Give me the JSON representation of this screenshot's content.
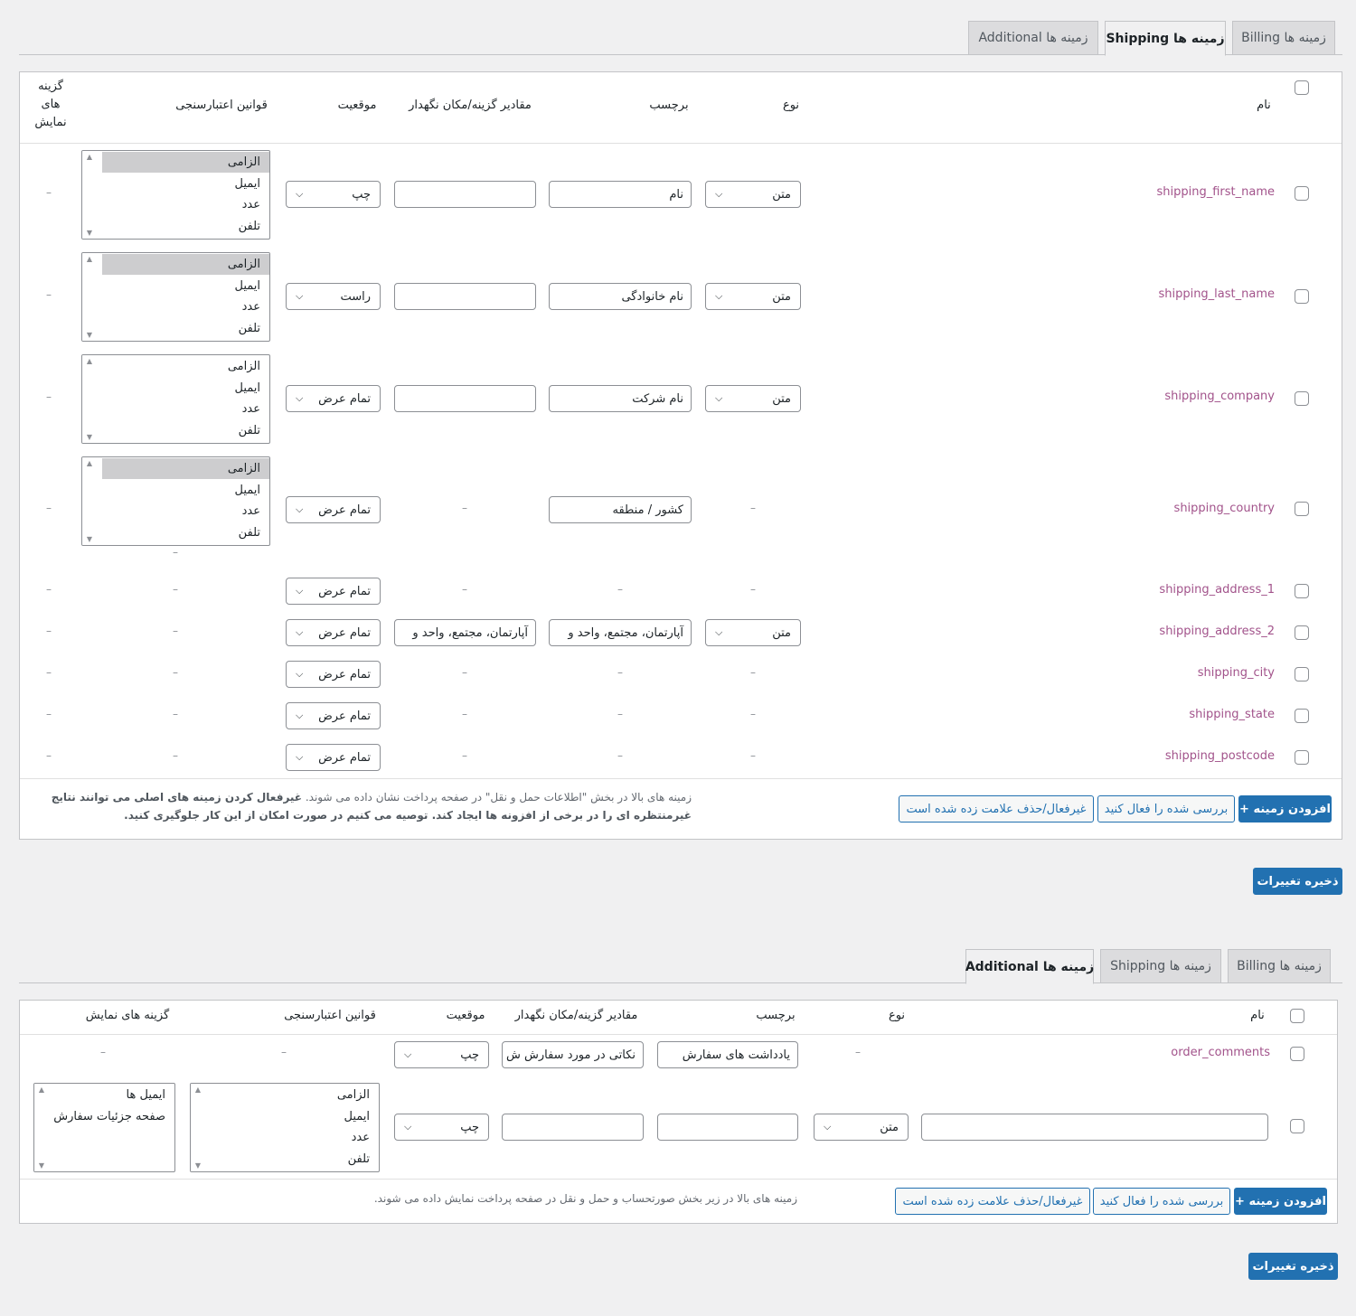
{
  "tabs": {
    "billing": "Billing زمینه ها",
    "shipping": "Shipping زمینه ها",
    "additional": "Additional زمینه ها"
  },
  "shipping_table": {
    "headers": {
      "name": "نام",
      "type": "نوع",
      "label": "برچسب",
      "placeholder": "مقادیر گزینه/مکان نگهدار",
      "position": "موقعیت",
      "validation": "قوانین اعتبارسنجی",
      "display_l1": "گزینه",
      "display_l2": "های",
      "display_l3": "نمایش"
    },
    "rows": [
      {
        "name": "shipping_first_name",
        "type": "متن",
        "label": "نام",
        "placeholder": "",
        "position": "چپ"
      },
      {
        "name": "shipping_last_name",
        "type": "متن",
        "label": "نام خانوادگی",
        "placeholder": "",
        "position": "راست"
      },
      {
        "name": "shipping_company",
        "type": "متن",
        "label": "نام شرکت",
        "placeholder": "",
        "position": "تمام عرض"
      },
      {
        "name": "shipping_country",
        "type": "–",
        "label": "کشور / منطقه",
        "placeholder": "–",
        "position": "تمام عرض"
      },
      {
        "name": "shipping_address_1",
        "type": "–",
        "label": "–",
        "placeholder": "–",
        "position": "تمام عرض"
      },
      {
        "name": "shipping_address_2",
        "type": "متن",
        "label": "آپارتمان، مجتمع، واحد و",
        "placeholder": "آپارتمان، مجتمع، واحد و",
        "position": "تمام عرض"
      },
      {
        "name": "shipping_city",
        "type": "–",
        "label": "–",
        "placeholder": "–",
        "position": "تمام عرض"
      },
      {
        "name": "shipping_state",
        "type": "–",
        "label": "–",
        "placeholder": "–",
        "position": "تمام عرض"
      },
      {
        "name": "shipping_postcode",
        "type": "–",
        "label": "–",
        "placeholder": "–",
        "position": "تمام عرض"
      }
    ],
    "validation_options": [
      "الزامی",
      "ایمیل",
      "عدد",
      "تلفن"
    ],
    "dash": "–",
    "note_normal": "زمینه های بالا در بخش \"اطلاعات حمل و نقل\" در صفحه پرداخت نشان داده می شوند.",
    "note_bold": "غیرفعال کردن زمینه های اصلی می توانند نتایج",
    "note_line2": "غیرمنتظره ای را در برخی از افزونه ها ایجاد کند. توصیه می کنیم در صورت امکان از این کار جلوگیری کنید."
  },
  "additional_table": {
    "headers": {
      "name": "نام",
      "type": "نوع",
      "label": "برچسب",
      "placeholder": "مقادیر گزینه/مکان نگهدار",
      "position": "موقعیت",
      "validation": "قوانین اعتبارسنجی",
      "display": "گزینه های نمایش"
    },
    "row1": {
      "name": "order_comments",
      "type": "–",
      "label": "یادداشت های سفارش",
      "placeholder": "نکاتی در مورد سفارش ش",
      "position": "چپ"
    },
    "row2": {
      "type": "متن",
      "position": "چپ"
    },
    "validation_options": [
      "الزامی",
      "ایمیل",
      "عدد",
      "تلفن"
    ],
    "display_options": [
      "ایمیل ها",
      "صفحه جزئیات سفارش"
    ],
    "note": "زمینه های بالا در زیر بخش صورتحساب و حمل و نقل در صفحه پرداخت نمایش داده می شوند."
  },
  "buttons": {
    "add_field": "+ افزودن زمینه",
    "enable_checked": "بررسی شده را فعال کنید",
    "disable_checked": "غیرفعال/حذف علامت زده شده است",
    "save": "ذخیره تغییرات"
  },
  "colors": {
    "accent": "#2271b1",
    "field_name": "#a2538b"
  }
}
